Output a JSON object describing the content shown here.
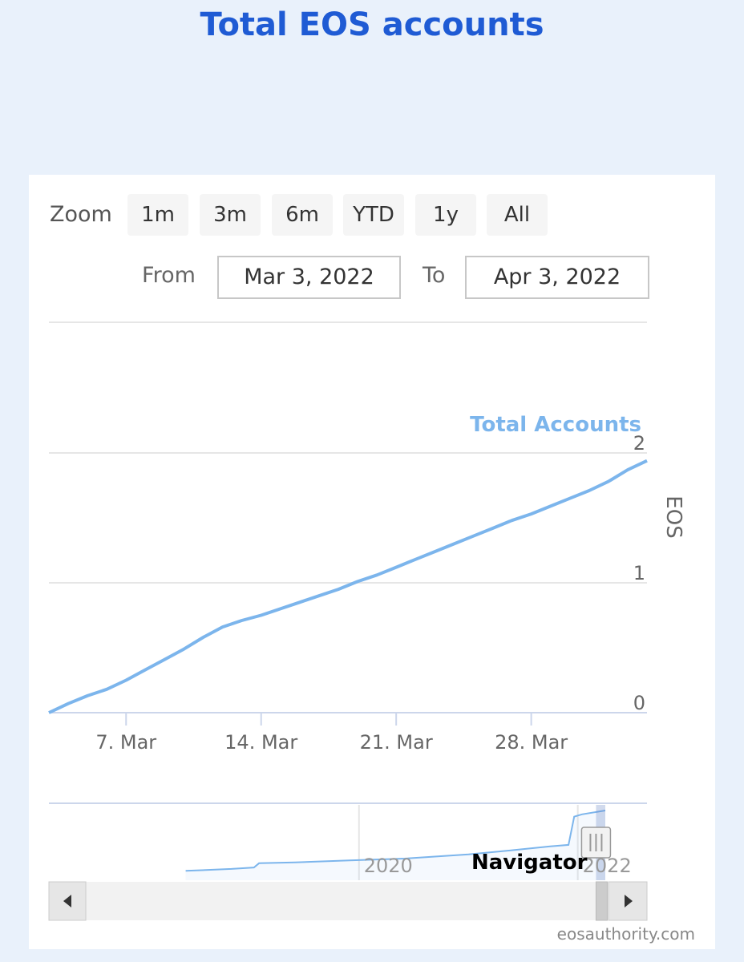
{
  "page": {
    "title": "Total EOS accounts"
  },
  "toolbar": {
    "zoom_label": "Zoom",
    "zoom_options": [
      "1m",
      "3m",
      "6m",
      "YTD",
      "1y",
      "All"
    ],
    "zoom_selected": "1m",
    "from_label": "From",
    "from_value": "Mar 3, 2022",
    "to_label": "To",
    "to_value": "Apr 3, 2022"
  },
  "chart_data": {
    "type": "line",
    "series": [
      {
        "name": "Total Accounts",
        "color": "#7cb5ec",
        "x": [
          "2022-03-03",
          "2022-03-04",
          "2022-03-05",
          "2022-03-06",
          "2022-03-07",
          "2022-03-08",
          "2022-03-09",
          "2022-03-10",
          "2022-03-11",
          "2022-03-12",
          "2022-03-13",
          "2022-03-14",
          "2022-03-15",
          "2022-03-16",
          "2022-03-17",
          "2022-03-18",
          "2022-03-19",
          "2022-03-20",
          "2022-03-21",
          "2022-03-22",
          "2022-03-23",
          "2022-03-24",
          "2022-03-25",
          "2022-03-26",
          "2022-03-27",
          "2022-03-28",
          "2022-03-29",
          "2022-03-30",
          "2022-03-31",
          "2022-04-01",
          "2022-04-02",
          "2022-04-03"
        ],
        "y": [
          0.0,
          0.07,
          0.13,
          0.18,
          0.25,
          0.33,
          0.41,
          0.49,
          0.58,
          0.66,
          0.71,
          0.75,
          0.8,
          0.85,
          0.9,
          0.95,
          1.01,
          1.06,
          1.12,
          1.18,
          1.24,
          1.3,
          1.36,
          1.42,
          1.48,
          1.53,
          1.59,
          1.65,
          1.71,
          1.78,
          1.87,
          1.94
        ]
      }
    ],
    "x_tick_labels": [
      "7. Mar",
      "14. Mar",
      "21. Mar",
      "28. Mar"
    ],
    "x_ticks": [
      "2022-03-07",
      "2022-03-14",
      "2022-03-21",
      "2022-03-28"
    ],
    "y_ticks": [
      0,
      1,
      2
    ],
    "ylabel": "EOS",
    "ylim": [
      0,
      2
    ],
    "grid": true,
    "navigator": {
      "label": "Navigator",
      "tick_labels": [
        "2020",
        "2022"
      ],
      "series": [
        {
          "date": "2018-06-01",
          "value": 0.2
        },
        {
          "date": "2018-11-01",
          "value": 0.24
        },
        {
          "date": "2019-01-15",
          "value": 0.27
        },
        {
          "date": "2019-02-01",
          "value": 0.36
        },
        {
          "date": "2019-06-01",
          "value": 0.38
        },
        {
          "date": "2019-12-01",
          "value": 0.42
        },
        {
          "date": "2020-06-01",
          "value": 0.46
        },
        {
          "date": "2021-01-01",
          "value": 0.55
        },
        {
          "date": "2021-06-01",
          "value": 0.64
        },
        {
          "date": "2021-10-01",
          "value": 0.72
        },
        {
          "date": "2021-12-01",
          "value": 0.75
        },
        {
          "date": "2021-12-20",
          "value": 1.35
        },
        {
          "date": "2022-01-15",
          "value": 1.4
        },
        {
          "date": "2022-04-03",
          "value": 1.48
        }
      ],
      "selected_from": "2022-03-03",
      "selected_to": "2022-04-03"
    }
  },
  "footer": {
    "credit": "eosauthority.com"
  }
}
